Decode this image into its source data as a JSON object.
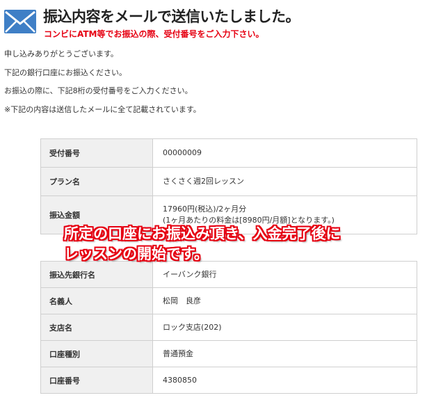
{
  "header": {
    "icon": "envelope-icon",
    "title": "振込内容をメールで送信いたしました。",
    "subtitle": "コンビにATM等でお振込の際、受付番号をご入力下さい。",
    "accent_color": "#e60012",
    "icon_color": "#3f7fc6"
  },
  "intro": [
    "申し込みありがとうございます。",
    "下記の銀行口座にお振込ください。",
    "お振込の際に、下記8桁の受付番号をご入力ください。",
    "※下記の内容は送信したメールに全て記載されています。"
  ],
  "order": {
    "reception_number_label": "受付番号",
    "reception_number": "00000009",
    "plan_label": "プラン名",
    "plan": "さくさく週2回レッスン",
    "amount_label": "振込金額",
    "amount_line1": "17960円(税込)/2ヶ月分",
    "amount_line2": "(1ヶ月あたりの料金は[8980円/月額]となります。)"
  },
  "bank": {
    "bank_name_label": "振込先銀行名",
    "bank_name": "イーバンク銀行",
    "holder_label": "名義人",
    "holder": "松岡　良彦",
    "branch_label": "支店名",
    "branch": "ロック支店(202)",
    "account_type_label": "口座種別",
    "account_type": "普通預金",
    "account_number_label": "口座番号",
    "account_number": "4380850"
  },
  "overlay": {
    "line1": "所定の口座にお振込み頂き、入金完了後に",
    "line2": "レッスンの開始です。"
  }
}
